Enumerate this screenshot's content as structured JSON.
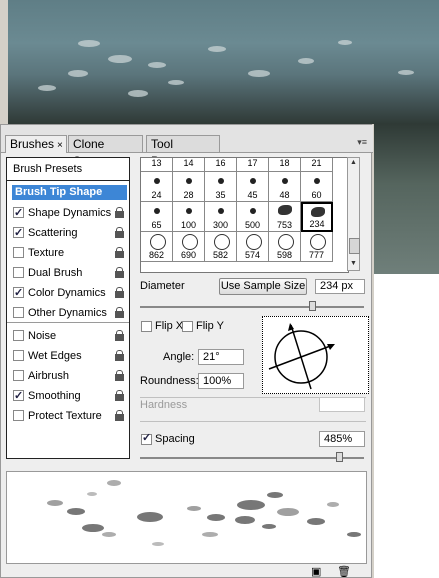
{
  "tabs": [
    {
      "label": "Brushes",
      "close": "×"
    },
    {
      "label": "Clone Source"
    },
    {
      "label": "Tool Presets"
    }
  ],
  "panel_menu": "▾≡",
  "left": {
    "presets": "Brush Presets",
    "tip_shape": "Brush Tip Shape",
    "options": [
      {
        "label": "Shape Dynamics",
        "checked": true,
        "lock": true
      },
      {
        "label": "Scattering",
        "checked": true,
        "lock": true
      },
      {
        "label": "Texture",
        "checked": false,
        "lock": true
      },
      {
        "label": "Dual Brush",
        "checked": false,
        "lock": true
      },
      {
        "label": "Color Dynamics",
        "checked": true,
        "lock": true
      },
      {
        "label": "Other Dynamics",
        "checked": false,
        "lock": true
      },
      {
        "label": "Noise",
        "checked": false,
        "lock": true
      },
      {
        "label": "Wet Edges",
        "checked": false,
        "lock": true
      },
      {
        "label": "Airbrush",
        "checked": false,
        "lock": true
      },
      {
        "label": "Smoothing",
        "checked": true,
        "lock": true
      },
      {
        "label": "Protect Texture",
        "checked": false,
        "lock": true
      }
    ]
  },
  "grid": {
    "top_row": [
      "13",
      "14",
      "16",
      "17",
      "18",
      "21"
    ],
    "row1": [
      "24",
      "28",
      "35",
      "45",
      "48",
      "60"
    ],
    "row2": [
      "65",
      "100",
      "300",
      "500",
      "753",
      "234"
    ],
    "row3": [
      "862",
      "690",
      "582",
      "574",
      "598",
      "777"
    ]
  },
  "diameter": {
    "label": "Diameter",
    "button": "Use Sample Size",
    "value": "234 px"
  },
  "flip_x": "Flip X",
  "flip_y": "Flip Y",
  "angle": {
    "label": "Angle:",
    "value": "21°"
  },
  "roundness": {
    "label": "Roundness:",
    "value": "100%"
  },
  "hardness": {
    "label": "Hardness",
    "value": ""
  },
  "spacing": {
    "label": "Spacing",
    "checked": true,
    "value": "485%"
  },
  "colors": {
    "selected": "#3d86d6",
    "panel": "#eeeeee"
  }
}
